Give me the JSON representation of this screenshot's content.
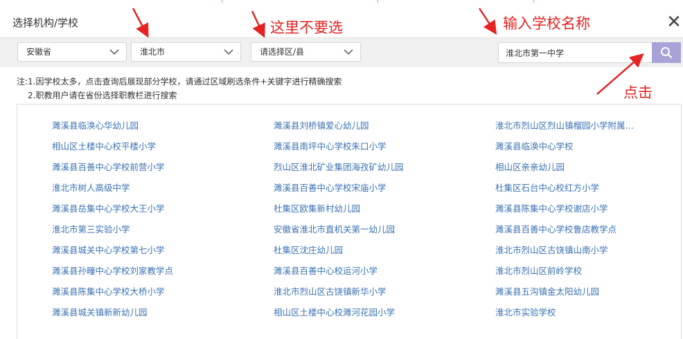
{
  "dialog": {
    "title": "选择机构/学校",
    "close_glyph": "✕"
  },
  "filters": {
    "province": "安徽省",
    "city": "淮北市",
    "district_placeholder": "请选择区/县"
  },
  "search": {
    "value": "淮北市第一中学",
    "button_icon": "search-icon"
  },
  "notes": {
    "line1": "注:1.因学校太多，点击查询后展现部分学校，请通过区域刷选条件+关键字进行精确搜索",
    "line2": "2.职教用户请在省份选择职教栏进行搜索"
  },
  "annotations": {
    "no_select": "这里不要选",
    "enter_school": "输入学校名称",
    "click": "点击",
    "color": "#e52323"
  },
  "results": [
    "濉溪县临涣心华幼儿园",
    "濉溪县刘桥镇爱心幼儿园",
    "淮北市烈山区烈山镇榴园小学附属…",
    "相山区土楼中心校平楼小学",
    "濉溪县南坪中心学校朱口小学",
    "濉溪县临涣中心学校",
    "濉溪县百善中心学校前营小学",
    "烈山区淮北矿业集团海孜矿幼儿园",
    "相山区亲亲幼儿园",
    "淮北市树人高级中学",
    "濉溪县百善中心学校宋庙小学",
    "杜集区石台中心校红方小学",
    "濉溪县岳集中心学校大王小学",
    "杜集区欧集新村幼儿园",
    "濉溪县陈集中心学校谢店小学",
    "淮北市第三实验小学",
    "安徽省淮北市直机关第一幼儿园",
    "濉溪县百善中心学校鲁店教学点",
    "濉溪县城关中心学校第七小学",
    "杜集区沈庄幼儿园",
    "淮北市烈山区古饶镇山南小学",
    "濉溪县孙疃中心学校刘家教学点",
    "濉溪县百善中心校运河小学",
    "淮北市烈山区前岭学校",
    "濉溪县陈集中心学校大桥小学",
    "淮北市烈山区古饶镇新华小学",
    "濉溪县五沟镇金太阳幼儿园",
    "濉溪县城关镇新新幼儿园",
    "相山区土楼中心校濉河花园小学",
    "淮北市实验学校"
  ]
}
